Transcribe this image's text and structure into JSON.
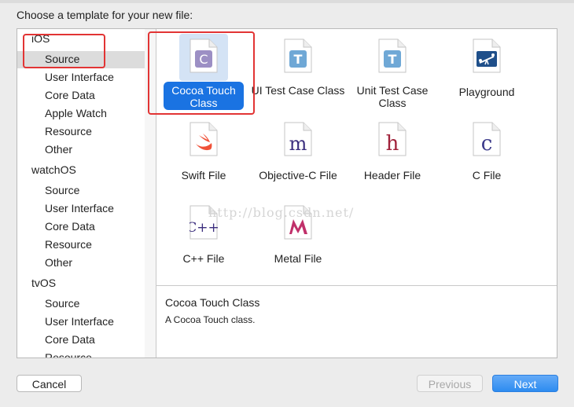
{
  "dialog": {
    "heading": "Choose a template for your new file:"
  },
  "sidebar": {
    "groups": [
      {
        "label": "iOS",
        "items": [
          "Source",
          "User Interface",
          "Core Data",
          "Apple Watch",
          "Resource",
          "Other"
        ]
      },
      {
        "label": "watchOS",
        "items": [
          "Source",
          "User Interface",
          "Core Data",
          "Resource",
          "Other"
        ]
      },
      {
        "label": "tvOS",
        "items": [
          "Source",
          "User Interface",
          "Core Data",
          "Resource"
        ]
      }
    ],
    "selected": "iOS / Source"
  },
  "templates": [
    {
      "label": "Cocoa Touch Class",
      "icon": "cocoa-touch-class-icon",
      "glyph": "C",
      "selected": true
    },
    {
      "label": "UI Test Case Class",
      "icon": "ui-test-case-icon",
      "glyph": "T"
    },
    {
      "label": "Unit Test Case Class",
      "icon": "unit-test-case-icon",
      "glyph": "T"
    },
    {
      "label": "Playground",
      "icon": "playground-icon",
      "glyph": ""
    },
    {
      "label": "Swift File",
      "icon": "swift-file-icon",
      "glyph": ""
    },
    {
      "label": "Objective-C File",
      "icon": "objc-file-icon",
      "glyph": "m"
    },
    {
      "label": "Header File",
      "icon": "header-file-icon",
      "glyph": "h"
    },
    {
      "label": "C File",
      "icon": "c-file-icon",
      "glyph": "c"
    },
    {
      "label": "C++ File",
      "icon": "cpp-file-icon",
      "glyph": "C++"
    },
    {
      "label": "Metal File",
      "icon": "metal-file-icon",
      "glyph": "M"
    }
  ],
  "description": {
    "title": "Cocoa Touch Class",
    "body": "A Cocoa Touch class."
  },
  "buttons": {
    "cancel": "Cancel",
    "previous": "Previous",
    "next": "Next"
  },
  "watermark": "http://blog.csdn.net/",
  "colors": {
    "accent": "#1a73e2",
    "highlight": "#e23434"
  }
}
